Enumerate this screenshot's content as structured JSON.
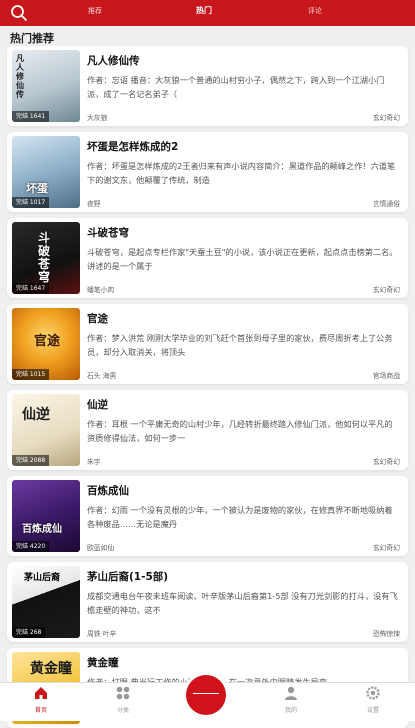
{
  "header": {
    "tabs": [
      {
        "label": "推荐",
        "active": false
      },
      {
        "label": "热门",
        "active": true
      },
      {
        "label": "评论",
        "active": false
      }
    ],
    "accent": "#c8161d"
  },
  "section_title": "热门推荐",
  "books": [
    {
      "title": "凡人修仙传",
      "desc": "作者：忘语 播音：大灰狼一个普通的山村穷小子，偶然之下，跨入到一个江湖小门派，成了一名记名弟子（",
      "author": "大灰狼",
      "genre": "玄幻奇幻",
      "badge": "完结 1641",
      "cover_text": "凡人修仙传"
    },
    {
      "title": "坏蛋是怎样炼成的2",
      "desc": "作者：坏蛋是怎样炼成的2王者归来有声小说内容简介：黑道作品的颠峰之作！六道笔下的谢文东，他颠覆了传统，制造",
      "author": "夜野",
      "genre": "言情通俗",
      "badge": "完结 1017",
      "cover_text": "坏蛋"
    },
    {
      "title": "斗破苍穹",
      "desc": "斗破苍穹，是起点专栏作家\"天蚕土豆\"的小说，该小说正在更新，起点点击榜第二名。 讲述的是一个属于",
      "author": "蟠笔小肉",
      "genre": "玄幻奇幻",
      "badge": "完结 1647",
      "cover_text": "斗破苍穹"
    },
    {
      "title": "官途",
      "desc": "作者：梦入洪荒 刚刚大学毕业的刘飞赶个首张到母子里的家伙，费尽周折考上了公务员，却分入取消关，将顶头",
      "author": "石头 海男",
      "genre": "官场商战",
      "badge": "完结 1015",
      "cover_text": "官途"
    },
    {
      "title": "仙逆",
      "desc": "作者：耳根 一个平庸无奇的山村少年，几经转折最终踏入修仙门派，他如何以平凡的资质修得仙法，如何一步一",
      "author": "朱宇",
      "genre": "玄幻奇幻",
      "badge": "完结 2088",
      "cover_text": "仙逆"
    },
    {
      "title": "百炼成仙",
      "desc": "作者：幻雨 一个没有灵根的少年，一个被认为是废物的家伙，在修真界不断地吸纳着各种废品……无论是魔丹",
      "author": "欧蓝如仙",
      "genre": "玄幻奇幻",
      "badge": "完结 4220",
      "cover_text": "百炼成仙"
    },
    {
      "title": "茅山后裔(1-5部)",
      "desc": "成都交通电台午夜未班车阅读、叶辛版茅山后裔第1-5部 没有刀光剑影的打斗，没有飞檐走壁的神功，这不",
      "author": "周铁 叶辛",
      "genre": "恐怖惊悚",
      "badge": "完结 268",
      "cover_text": "茅山后裔"
    },
    {
      "title": "黄金瞳",
      "desc": "作者：打眼 典当行工作的小职员庄睿，在一次意外中眼睛发生异变，",
      "author": "",
      "genre": "",
      "badge": "",
      "cover_text": "黄金瞳"
    }
  ],
  "bottom_nav": [
    {
      "label": "首页",
      "active": true,
      "icon": "home-icon"
    },
    {
      "label": "分类",
      "active": false,
      "icon": "category-icon"
    },
    {
      "label": "",
      "active": false,
      "icon": "center-listen-icon"
    },
    {
      "label": "我的",
      "active": false,
      "icon": "user-icon"
    },
    {
      "label": "设置",
      "active": false,
      "icon": "settings-icon"
    }
  ]
}
